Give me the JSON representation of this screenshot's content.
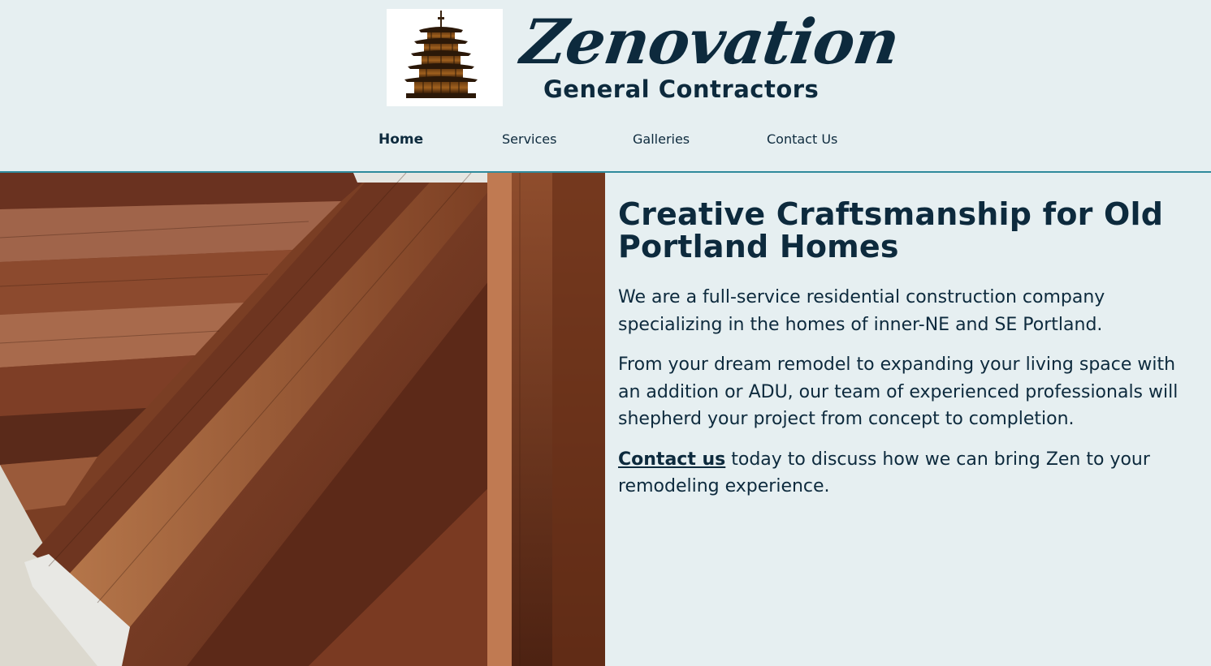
{
  "brand": {
    "name": "Zenovation",
    "subtitle": "General Contractors",
    "logo_icon": "pagoda-icon"
  },
  "nav": {
    "items": [
      {
        "label": "Home",
        "active": true
      },
      {
        "label": "Services",
        "active": false
      },
      {
        "label": "Galleries",
        "active": false
      },
      {
        "label": "Contact Us",
        "active": false
      }
    ]
  },
  "hero": {
    "image": "wooden-staircase-photo"
  },
  "main": {
    "headline": "Creative Craftsmanship for Old Portland Homes",
    "paragraph1": "We are a full-service residential construction company specializing in the homes of inner-NE and SE Portland.",
    "paragraph2": "From your dream remodel to expanding your living space with an addition or ADU, our team of experienced professionals will shepherd your project from concept to completion.",
    "paragraph3_link": "Contact us",
    "paragraph3_rest": " today to discuss how we can bring Zen to your remodeling experience."
  },
  "colors": {
    "background": "#e6eff1",
    "text": "#0d2a3d",
    "divider": "#2f8a9c"
  }
}
